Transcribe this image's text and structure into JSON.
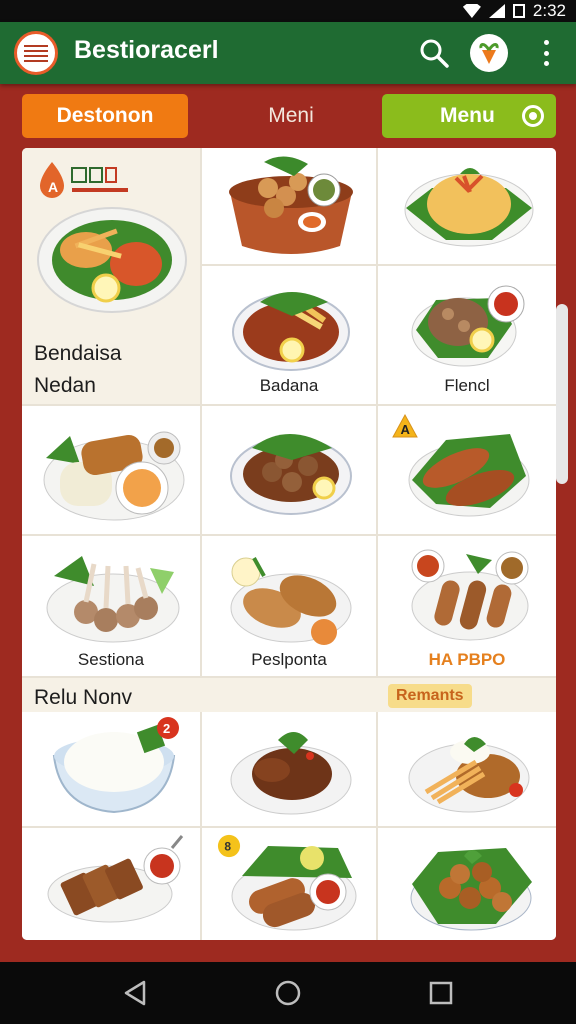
{
  "status": {
    "time": "2:32"
  },
  "app": {
    "title": "Bestioracerl"
  },
  "tabs": {
    "left": "Destonon",
    "middle": "Meni",
    "right": "Menu"
  },
  "feature": {
    "title_line1": "Bendaisa",
    "title_line2": "Nedan",
    "badge": "A"
  },
  "dishes": {
    "b": "Badana",
    "c": "Flencl",
    "e": "Sestiona",
    "f": "Peslponta",
    "g": "HA PBPO",
    "a_badge": "A",
    "r_badge": "2"
  },
  "sections": {
    "left": "Relu Nonv",
    "right": "Remants"
  },
  "icons": [
    "search-icon",
    "vegetable-icon",
    "more-vert-icon",
    "back-icon",
    "home-icon",
    "recents-icon"
  ],
  "colors": {
    "app_bar": "#1f6b32",
    "background": "#9e2a20",
    "tab_orange": "#f07a12",
    "tab_green": "#8bbc1c"
  }
}
